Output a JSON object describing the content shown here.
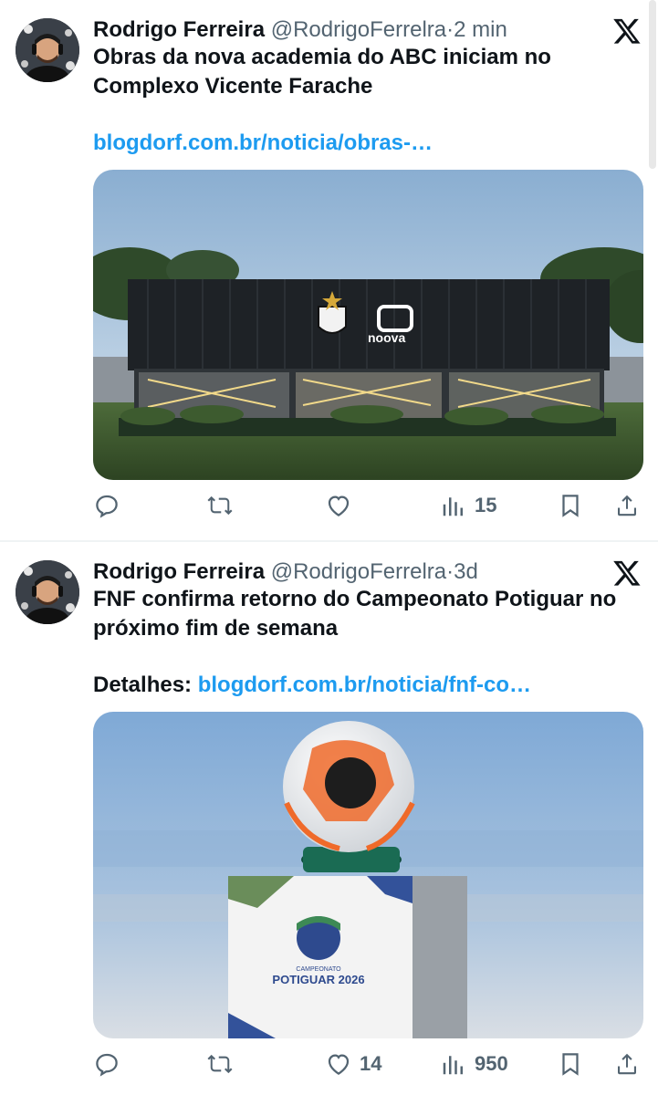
{
  "tweets": [
    {
      "author": "Rodrigo Ferreira",
      "handle": "@RodrigoFerrelra",
      "separator": "·",
      "time": "2 min",
      "text": "Obras da nova academia do ABC iniciam no Complexo Vicente Farache",
      "link_prefix": "",
      "link": "blogdorf.com.br/noticia/obras-…",
      "media_text": "noova",
      "actions": {
        "reply": "",
        "retweet": "",
        "like": "",
        "views": "15"
      }
    },
    {
      "author": "Rodrigo Ferreira",
      "handle": "@RodrigoFerrelra",
      "separator": "·",
      "time": "3d",
      "text": "FNF confirma retorno do Campeonato Potiguar no próximo fim de semana",
      "link_prefix": "Detalhes: ",
      "link": "blogdorf.com.br/noticia/fnf-co…",
      "media_text_small": "CAMPEONATO",
      "media_text": "POTIGUAR 2026",
      "actions": {
        "reply": "",
        "retweet": "",
        "like": "14",
        "views": "950"
      }
    }
  ],
  "colors": {
    "link": "#1d9bf0",
    "muted": "#536471",
    "text": "#0f1419"
  },
  "icons": [
    "x-logo-icon",
    "reply-icon",
    "retweet-icon",
    "like-icon",
    "views-icon",
    "bookmark-icon",
    "share-icon"
  ]
}
